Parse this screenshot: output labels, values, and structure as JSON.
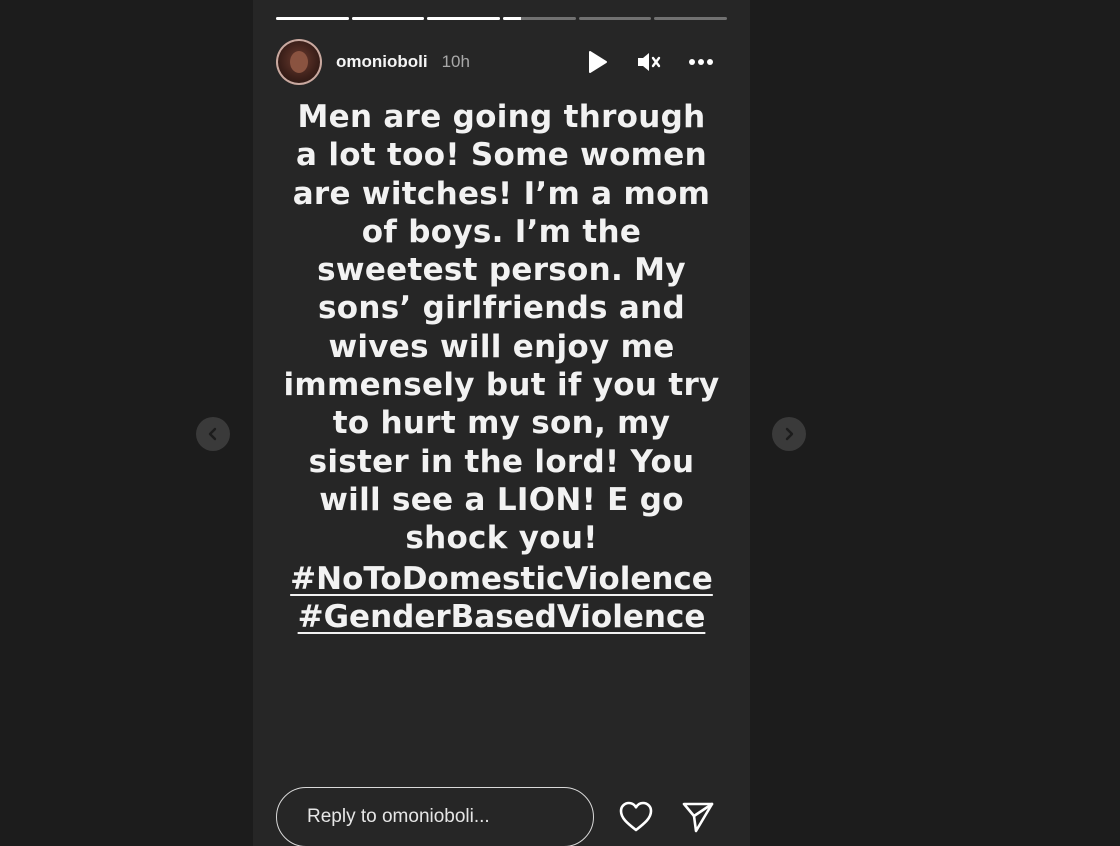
{
  "progress": [
    1,
    1,
    1,
    0.25,
    0,
    0
  ],
  "header": {
    "username": "omonioboli",
    "time": "10h"
  },
  "story": {
    "text": "Men are going through\na lot too! Some women\nare witches! I’m a mom\nof boys. I’m the\nsweetest person. My\nsons’ girlfriends and\nwives will enjoy me\nimmensely but if you try\nto hurt my son, my\nsister in the lord! You\nwill see a LION! E go\nshock you!",
    "hashtags": [
      "#NoToDomesticViolence",
      "#GenderBasedViolence"
    ]
  },
  "footer": {
    "reply_placeholder": "Reply to omonioboli..."
  },
  "icons": {
    "play": "play-icon",
    "mute": "muted-speaker-icon",
    "more": "more-horizontal-icon",
    "like": "heart-icon",
    "share": "send-icon",
    "prev": "chevron-left-icon",
    "next": "chevron-right-icon"
  },
  "colors": {
    "background": "#1c1c1c",
    "story_background": "#262626",
    "text": "#f2f2f2",
    "muted_text": "#a8a8a8"
  }
}
